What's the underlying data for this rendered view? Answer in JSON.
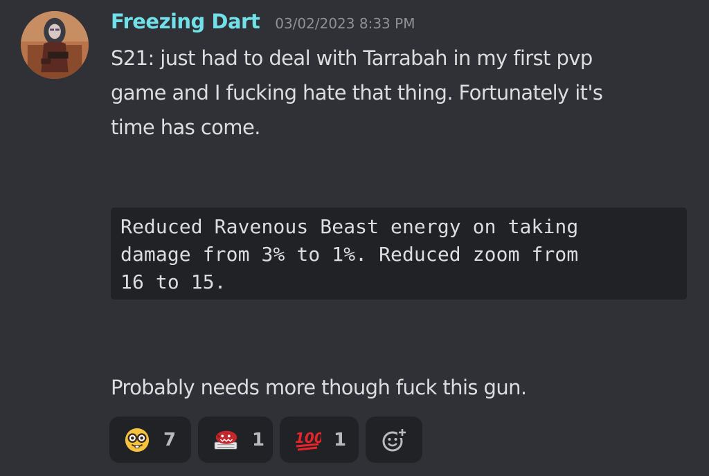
{
  "message": {
    "author": "Freezing Dart",
    "timestamp": "03/02/2023 8:33 PM",
    "author_color": "#72e0e8",
    "body_lines": [
      "S21: just had to deal with Tarrabah in my first pvp",
      "game and I fucking hate that thing. Fortunately it's",
      "time has come."
    ],
    "code_lines": [
      "Reduced Ravenous Beast energy on taking",
      "damage from 3% to 1%. Reduced zoom from",
      "16 to 15."
    ],
    "footer_line": "Probably needs more though fuck this gun."
  },
  "reactions": [
    {
      "icon": "nerd-face-emoji-icon",
      "count": "7"
    },
    {
      "icon": "red-creature-keyboard-emoji-icon",
      "count": "1"
    },
    {
      "icon": "hundred-points-emoji-icon",
      "count": "1"
    },
    {
      "icon": "add-reaction-icon"
    }
  ],
  "colors": {
    "background": "#2f3136",
    "codeblock": "#202225",
    "reaction_bg": "#202225",
    "text": "#dcddde",
    "muted": "#8e9297"
  }
}
